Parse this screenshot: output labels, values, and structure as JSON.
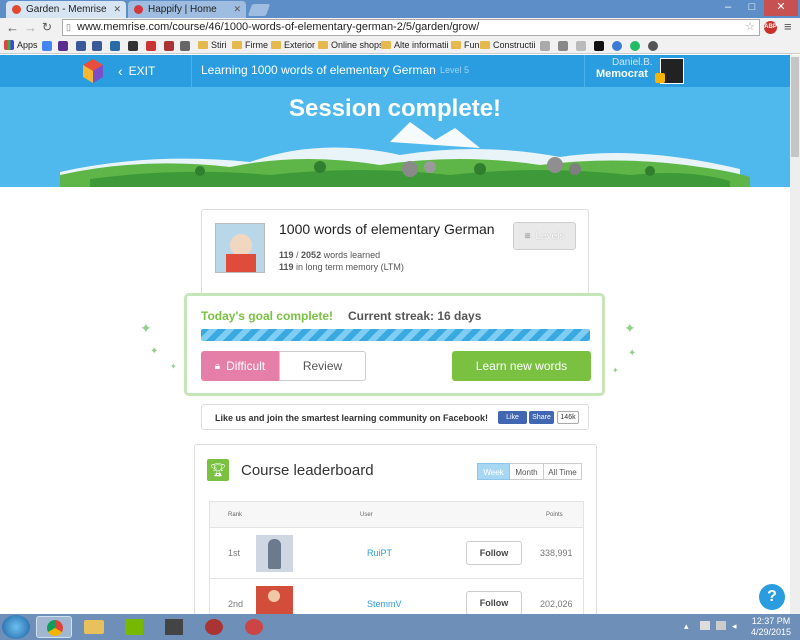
{
  "browser": {
    "tabs": [
      {
        "title": "Garden - Memrise",
        "active": true
      },
      {
        "title": "Happify | Home",
        "active": false
      }
    ],
    "url": "www.memrise.com/course/46/1000-words-of-elementary-german-2/5/garden/grow/",
    "bookmarks": [
      "Apps",
      "Stiri",
      "Firme",
      "Exterior",
      "Online shops",
      "Alte informatii",
      "Fun",
      "Constructii"
    ],
    "abp_label": "ABP"
  },
  "header": {
    "exit_label": "EXIT",
    "title": "Learning 1000 words of elementary German",
    "level": "Level 5",
    "user_name": "Daniel.B.",
    "user_rank": "Memocrat"
  },
  "hero": {
    "title": "Session complete!"
  },
  "course": {
    "name": "1000 words of elementary German",
    "learned": "119",
    "total": "2052",
    "learned_suffix": "words learned",
    "ltm": "119",
    "ltm_suffix": "in long term memory (LTM)",
    "levels_label": "Levels"
  },
  "goal": {
    "complete_text": "Today's goal complete!",
    "streak_text": "Current streak: 16 days",
    "progress": 1.0,
    "difficult_label": "Difficult",
    "review_label": "Review",
    "learn_label": "Learn new words"
  },
  "facebook": {
    "text": "Like us and join the smartest learning community on Facebook!",
    "like_label": "Like",
    "share_label": "Share",
    "count": "146k"
  },
  "leaderboard": {
    "title": "Course leaderboard",
    "tabs": [
      "Week",
      "Month",
      "All Time"
    ],
    "active_tab": "Week",
    "columns": [
      "Rank",
      "User",
      "Points"
    ],
    "rows": [
      {
        "rank": "1st",
        "user": "RuiPT",
        "points": "338,991",
        "follow": "Follow"
      },
      {
        "rank": "2nd",
        "user": "StemmV",
        "points": "202,026",
        "follow": "Follow"
      }
    ]
  },
  "taskbar": {
    "time": "12:37 PM",
    "date": "4/29/2015"
  },
  "colors": {
    "header": "#2a9ce0",
    "sky": "#4fb8ec",
    "green": "#7ac142",
    "pink": "#e57fa8",
    "link": "#2a9ce0"
  }
}
